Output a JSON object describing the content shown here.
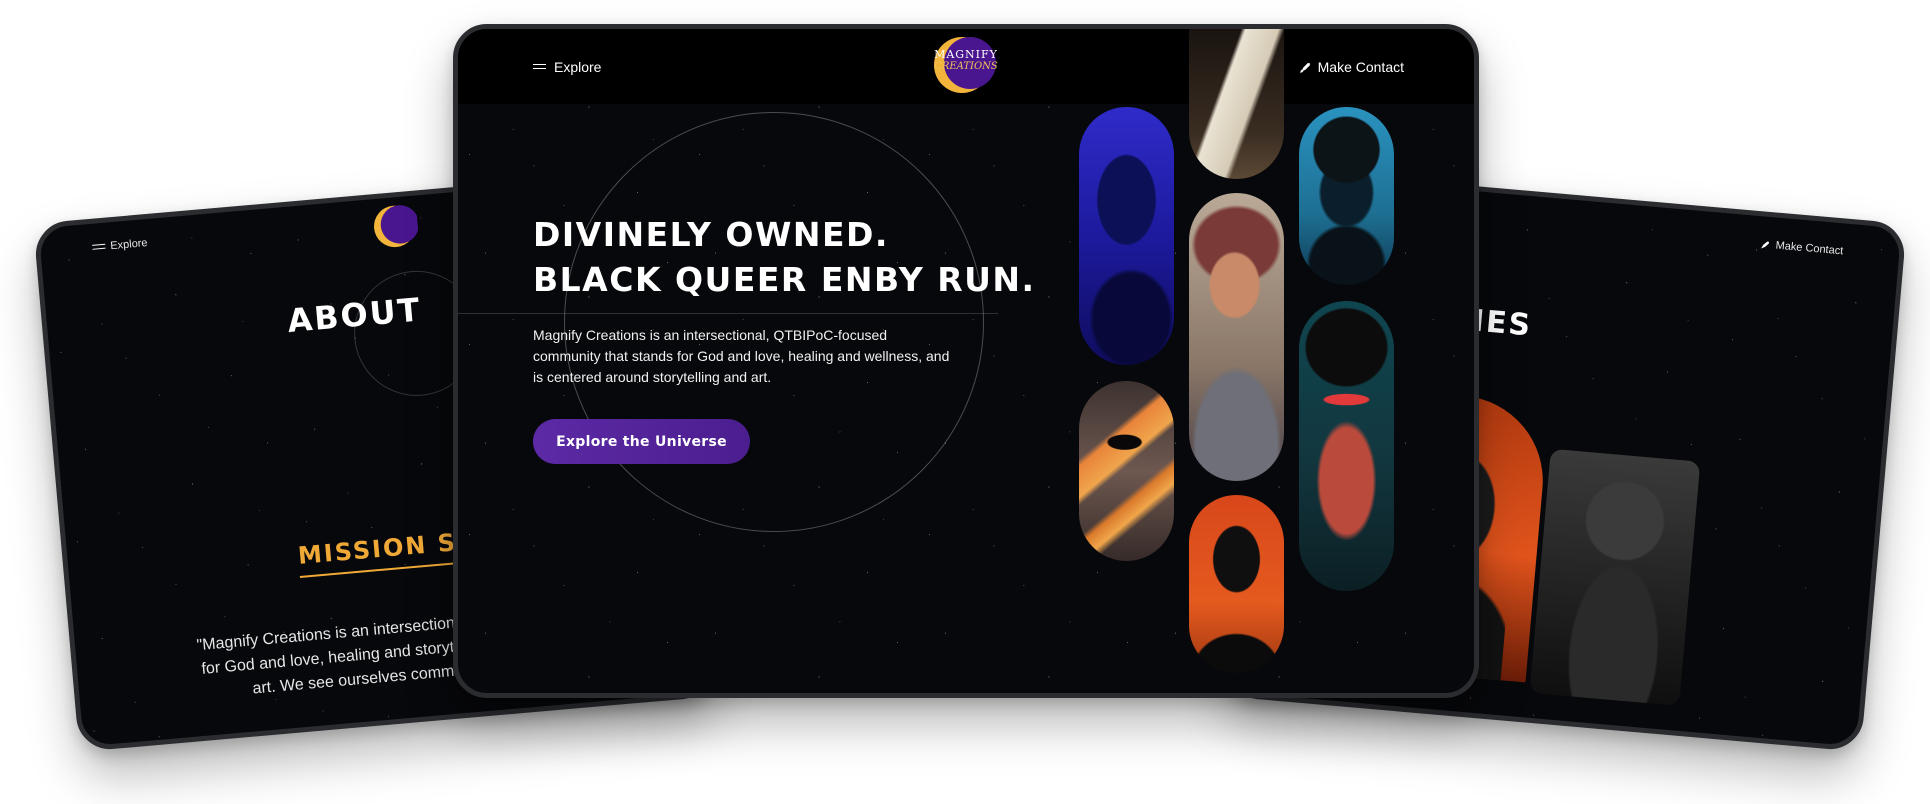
{
  "left_tablet": {
    "nav_explore": "Explore",
    "about_title": "ABOUT",
    "mission_title": "MISSION STA",
    "mission_quote": "\"Magnify Creations is an intersectional, stands for God and love, healing and storytelling and art. We see ourselves communi"
  },
  "right_tablet": {
    "nav_contact": "Make Contact",
    "series_title": "O SERIES"
  },
  "center": {
    "nav_explore": "Explore",
    "nav_contact": "Make Contact",
    "logo_line1": "MAGNIFY",
    "logo_line2": "CREATIONS",
    "hero_title_line1": "DIVINELY OWNED.",
    "hero_title_line2": "BLACK QUEER ENBY RUN.",
    "hero_description": "Magnify Creations is an intersectional, QTBIPoC-focused community that stands for God and love, healing and wellness, and is centered around storytelling and art.",
    "cta_label": "Explore the Universe"
  },
  "colors": {
    "background": "#07080b",
    "accent_purple": "#5c2aa5",
    "accent_gold": "#f0a937",
    "logo_purple": "#4a168f",
    "logo_gold": "#f2b43a"
  },
  "icons": [
    "hamburger-icon",
    "rocket-icon"
  ]
}
